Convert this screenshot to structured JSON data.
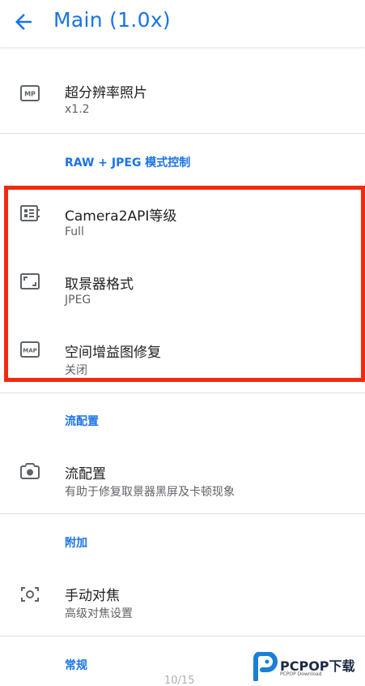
{
  "app_bar": {
    "title": "Main (1.0x)",
    "back_icon": "arrow-left-icon",
    "accent_color": "#1a73e8"
  },
  "sections": {
    "top": {
      "items": [
        {
          "icon": "mp-badge-icon",
          "title": "超分辨率照片",
          "summary": "x1.2"
        }
      ]
    },
    "raw_jpeg": {
      "header": "RAW + JPEG 模式控制",
      "items": [
        {
          "icon": "camera-api-icon",
          "title": "Camera2API等级",
          "summary": "Full"
        },
        {
          "icon": "viewfinder-icon",
          "title": "取景器格式",
          "summary": "JPEG"
        },
        {
          "icon": "map-badge-icon",
          "title": "空间增益图修复",
          "summary": "关闭"
        }
      ]
    },
    "stream": {
      "header": "流配置",
      "items": [
        {
          "icon": "camera-icon",
          "title": "流配置",
          "summary": "有助于修复取景器黑屏及卡顿现象"
        }
      ]
    },
    "extra": {
      "header": "附加",
      "items": [
        {
          "icon": "focus-icon",
          "title": "手动对焦",
          "summary": "高级对焦设置"
        }
      ]
    },
    "general": {
      "header": "常规"
    }
  },
  "page_indicator": "10/15",
  "highlight_color": "#f02b10",
  "watermark": {
    "brand": "PCPOP下载",
    "subtitle": "PCPOP Download"
  }
}
